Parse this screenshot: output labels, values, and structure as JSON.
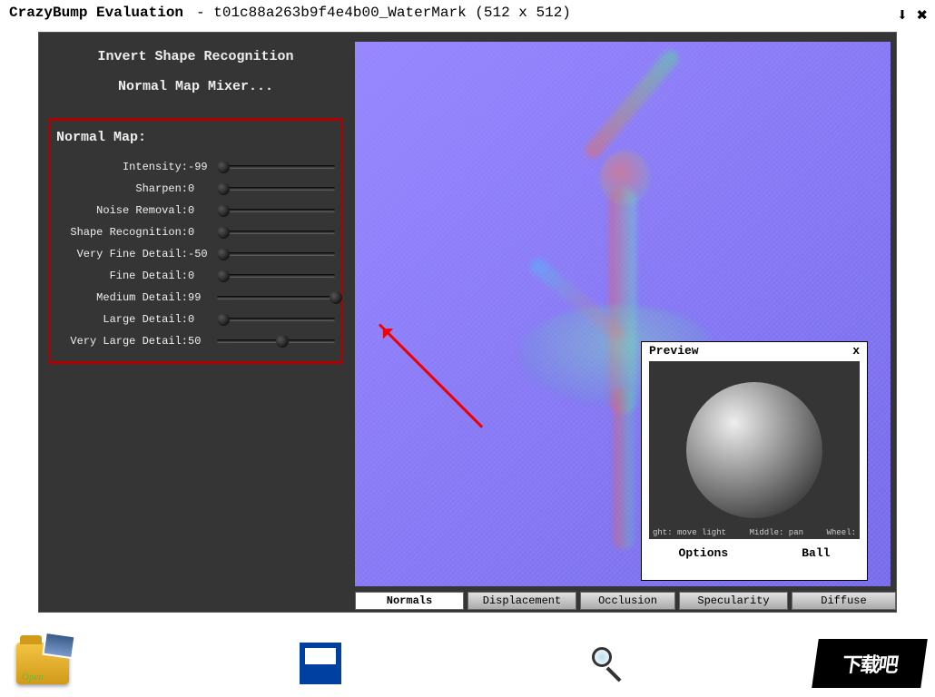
{
  "title": {
    "app": "CrazyBump Evaluation",
    "file": "- t01c88a263b9f4e4b00_WaterMark (512 x 512)"
  },
  "sidebar": {
    "invert_label": "Invert Shape Recognition",
    "mixer_label": "Normal Map Mixer..."
  },
  "normal_map": {
    "title": "Normal Map:",
    "sliders": [
      {
        "label": "Intensity",
        "value": "-99",
        "pos": 0
      },
      {
        "label": "Sharpen",
        "value": "0",
        "pos": 0
      },
      {
        "label": "Noise Removal",
        "value": "0",
        "pos": 0
      },
      {
        "label": "Shape Recognition",
        "value": "0",
        "pos": 0
      },
      {
        "label": "Very Fine Detail",
        "value": "-50",
        "pos": 0
      },
      {
        "label": "Fine Detail",
        "value": "0",
        "pos": 0
      },
      {
        "label": "Medium Detail",
        "value": "99",
        "pos": 95
      },
      {
        "label": "Large Detail",
        "value": "0",
        "pos": 0
      },
      {
        "label": "Very Large Detail",
        "value": "50",
        "pos": 50
      }
    ]
  },
  "tabs": [
    {
      "label": "Normals",
      "selected": true
    },
    {
      "label": "Displacement",
      "selected": false
    },
    {
      "label": "Occlusion",
      "selected": false
    },
    {
      "label": "Specularity",
      "selected": false
    },
    {
      "label": "Diffuse",
      "selected": false
    }
  ],
  "preview": {
    "title": "Preview",
    "hint_left": "ght: move light",
    "hint_mid": "Middle: pan",
    "hint_right": "Wheel:",
    "options_label": "Options",
    "ball_label": "Ball"
  },
  "bottom": {
    "open_label": "Open",
    "save_label": "Save",
    "logo_label": "下载吧"
  }
}
